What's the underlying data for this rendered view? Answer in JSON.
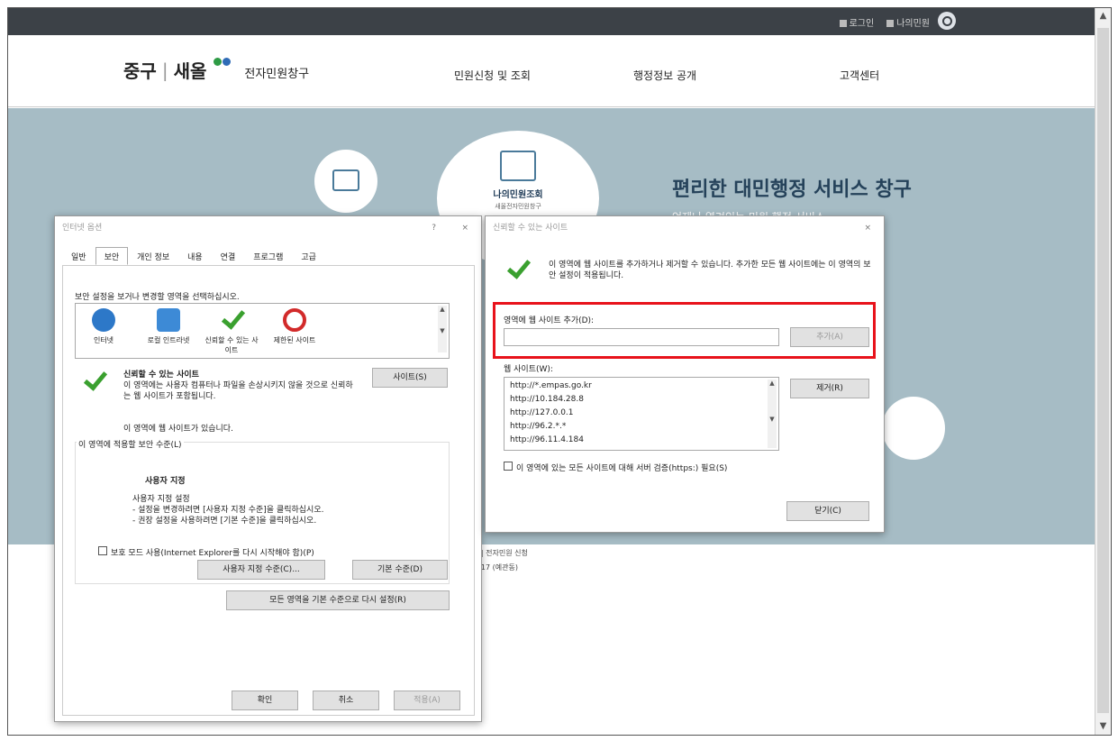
{
  "topbar": {
    "login": "로그인",
    "myinfo": "나의민원"
  },
  "header": {
    "logo_district": "중구",
    "logo_sep": "|",
    "logo_main": "새올",
    "logo_sub": "전자민원창구",
    "nav": [
      "민원신청 및 조회",
      "행정정보 공개",
      "고객센터"
    ],
    "logo_dot_colors": [
      "#2e9b45",
      "#2f6bb6"
    ]
  },
  "hero": {
    "title": "편리한 대민행정 서비스 창구",
    "subtitle": "언제나 열려있는 민원 행정 서비스",
    "center_title": "나의민원조회",
    "center_sub": "새올전자민원창구"
  },
  "footer": {
    "line1": "구 | 전자민원 신청",
    "line2": "로 17 (예관동)"
  },
  "inet_dialog": {
    "title": "인터넷 옵션",
    "help": "?",
    "close": "×",
    "tabs": [
      "일반",
      "보안",
      "개인 정보",
      "내용",
      "연결",
      "프로그램",
      "고급"
    ],
    "active_tab": "보안",
    "zone_prompt": "보안 설정을 보거나 변경할 영역을 선택하십시오.",
    "zones": [
      {
        "label": "인터넷",
        "icon": "globe-icon",
        "color": "#2d78c8"
      },
      {
        "label": "로컬 인트라넷",
        "icon": "intranet-icon",
        "color": "#3d8ad6"
      },
      {
        "label": "신뢰할 수 있는 사이트",
        "icon": "checkmark-icon",
        "color": "#3aa02f"
      },
      {
        "label": "제한된 사이트",
        "icon": "forbidden-icon",
        "color": "#d22a2a"
      }
    ],
    "zone_name": "신뢰할 수 있는 사이트",
    "zone_desc": "이 영역에는 사용자 컴퓨터나 파일을 손상시키지 않을 것으로 신뢰하는 웹 사이트가 포함됩니다.",
    "sites_button": "사이트(S)",
    "has_sites": "이 영역에 웹 사이트가 있습니다.",
    "level_label": "이 영역에 적용할 보안 수준(L)",
    "custom_title": "사용자 지정",
    "custom_l1": "사용자 지정 설정",
    "custom_l2": "- 설정을 변경하려면 [사용자 지정 수준]을 클릭하십시오.",
    "custom_l3": "- 권장 설정을 사용하려면 [기본 수준]을 클릭하십시오.",
    "protected_mode": "보호 모드 사용(Internet Explorer를 다시 시작해야 함)(P)",
    "custom_level_button": "사용자 지정 수준(C)...",
    "default_level_button": "기본 수준(D)",
    "reset_all_button": "모든 영역을 기본 수준으로 다시 설정(R)",
    "ok": "확인",
    "cancel": "취소",
    "apply": "적용(A)"
  },
  "trust_dialog": {
    "title": "신뢰할 수 있는 사이트",
    "close": "×",
    "info": "이 영역에 웹 사이트를 추가하거나 제거할 수 있습니다. 추가한 모든 웹 사이트에는 이 영역의 보안 설정이 적용됩니다.",
    "add_label": "영역에 웹 사이트 추가(D):",
    "add_value": "",
    "add_button": "추가(A)",
    "sites_label": "웹 사이트(W):",
    "sites": [
      "http://*.empas.go.kr",
      "http://10.184.28.8",
      "http://127.0.0.1",
      "http://96.2.*.*",
      "http://96.11.4.184"
    ],
    "remove_button": "제거(R)",
    "https_label": "이 영역에 있는 모든 사이트에 대해 서버 검증(https:) 필요(S)",
    "close_button": "닫기(C)"
  },
  "scrollbar": {
    "up": "▲",
    "down": "▼"
  }
}
